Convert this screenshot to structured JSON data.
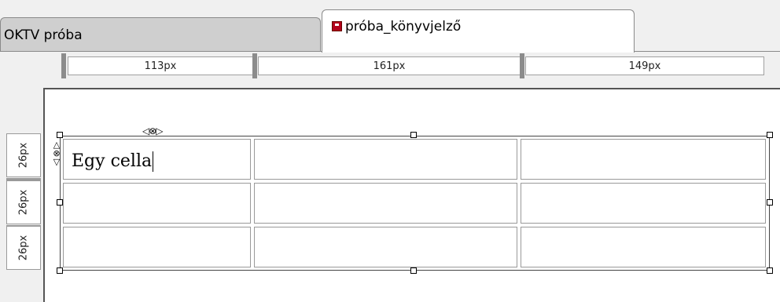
{
  "tabs": [
    {
      "label": "OKTV próba",
      "active": false
    },
    {
      "label": "próba_könyvjelző",
      "active": true,
      "icon": "document-icon"
    }
  ],
  "ruler": {
    "columns": [
      "113px",
      "161px",
      "149px"
    ],
    "rows": [
      "26px",
      "26px",
      "26px"
    ]
  },
  "table": {
    "rows": [
      [
        "Egy cella",
        "",
        ""
      ],
      [
        "",
        "",
        ""
      ],
      [
        "",
        "",
        ""
      ]
    ]
  },
  "colors": {
    "tab_inactive": "#cfcfcf",
    "tab_active": "#ffffff",
    "doc_icon": "#b3001b"
  }
}
